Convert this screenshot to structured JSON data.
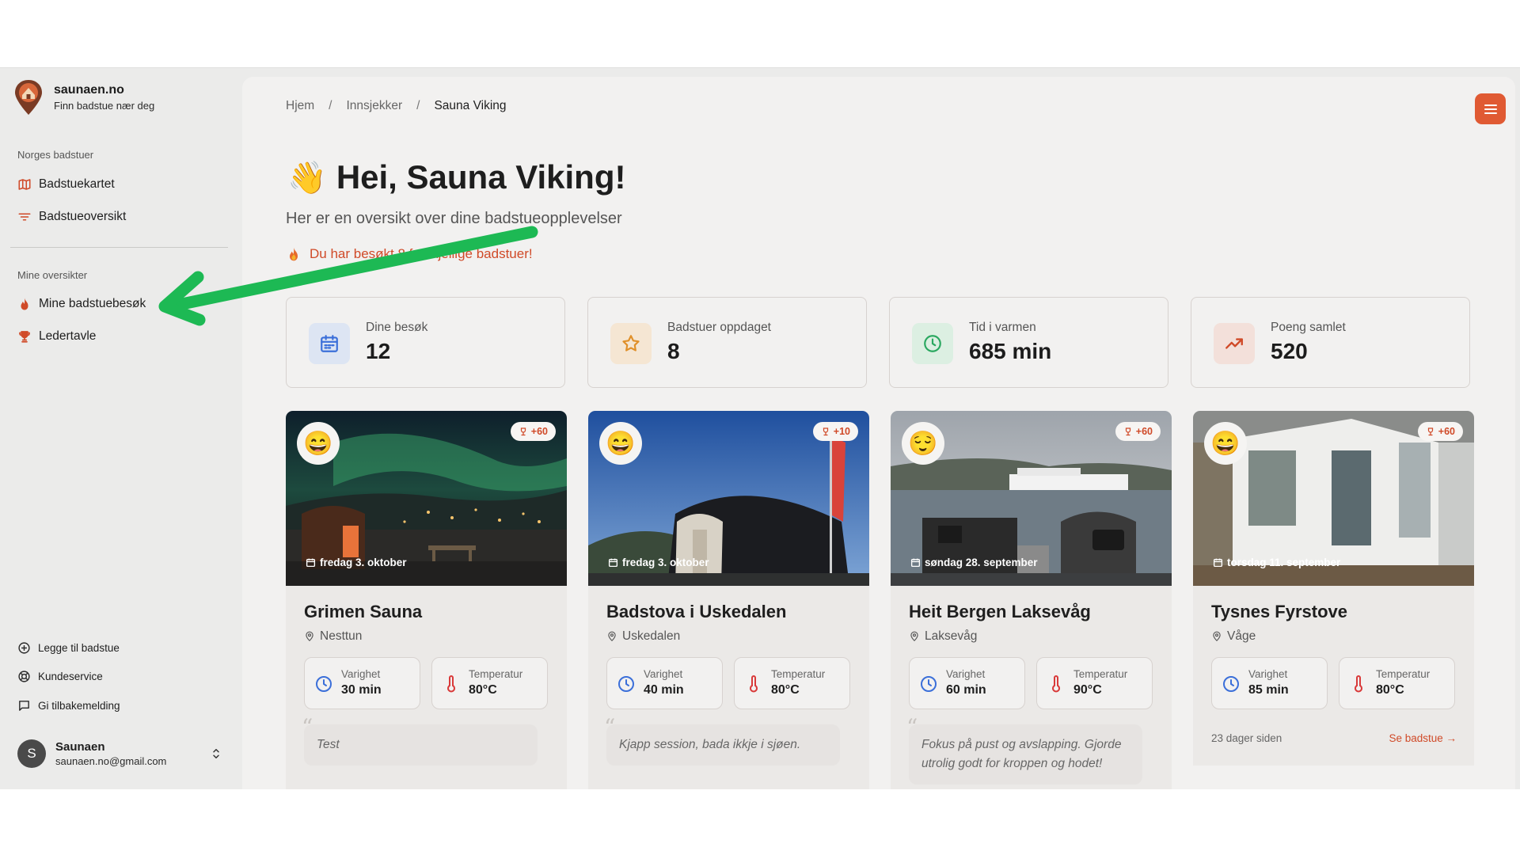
{
  "brand": {
    "name": "saunaen.no",
    "tagline": "Finn badstue nær deg"
  },
  "sidebar": {
    "section1_label": "Norges badstuer",
    "section1_items": [
      {
        "label": "Badstuekartet",
        "icon": "map-icon"
      },
      {
        "label": "Badstueoversikt",
        "icon": "filter-icon"
      }
    ],
    "section2_label": "Mine oversikter",
    "section2_items": [
      {
        "label": "Mine badstuebesøk",
        "icon": "flame-icon"
      },
      {
        "label": "Ledertavle",
        "icon": "trophy-icon"
      }
    ],
    "footer_items": [
      {
        "label": "Legge til badstue",
        "icon": "plus-circle-icon"
      },
      {
        "label": "Kundeservice",
        "icon": "lifebuoy-icon"
      },
      {
        "label": "Gi tilbakemelding",
        "icon": "message-icon"
      }
    ],
    "user": {
      "initial": "S",
      "name": "Saunaen",
      "email": "saunaen.no@gmail.com"
    }
  },
  "breadcrumb": {
    "items": [
      "Hjem",
      "Innsjekker",
      "Sauna Viking"
    ],
    "separator": "/"
  },
  "header": {
    "greeting_icon": "👋",
    "title": "Hei, Sauna Viking!",
    "subtitle": "Her er en oversikt over dine badstueopplevelser",
    "streak_text": "Du har besøkt 8 forskjellige badstuer!"
  },
  "stats": [
    {
      "label": "Dine besøk",
      "value": "12",
      "icon": "calendar-icon",
      "color": "#3b6fd9",
      "bg": "#dde5f3"
    },
    {
      "label": "Badstuer oppdaget",
      "value": "8",
      "icon": "star-icon",
      "color": "#e0902a",
      "bg": "#f5e6d3"
    },
    {
      "label": "Tid i varmen",
      "value": "685 min",
      "icon": "clock-icon",
      "color": "#2aa860",
      "bg": "#dcefe2"
    },
    {
      "label": "Poeng samlet",
      "value": "520",
      "icon": "trending-up-icon",
      "color": "#d04a28",
      "bg": "#f3e0da"
    }
  ],
  "labels": {
    "duration": "Varighet",
    "temperature": "Temperatur"
  },
  "visits": [
    {
      "date": "fredag 3. oktober",
      "points": "+60",
      "name": "Grimen Sauna",
      "location": "Nesttun",
      "duration": "30 min",
      "temperature": "80°C",
      "note": "Test",
      "mood": "😄"
    },
    {
      "date": "fredag 3. oktober",
      "points": "+10",
      "name": "Badstova i Uskedalen",
      "location": "Uskedalen",
      "duration": "40 min",
      "temperature": "80°C",
      "note": "Kjapp session, bada ikkje i sjøen.",
      "mood": "😄"
    },
    {
      "date": "søndag 28. september",
      "points": "+60",
      "name": "Heit Bergen Laksevåg",
      "location": "Laksevåg",
      "duration": "60 min",
      "temperature": "90°C",
      "note": "Fokus på pust og avslapping. Gjorde utrolig godt for kroppen og hodet!",
      "mood": "😌"
    },
    {
      "date": "torsdag 11. september",
      "points": "+60",
      "name": "Tysnes Fyrstove",
      "location": "Våge",
      "duration": "85 min",
      "temperature": "80°C",
      "ago": "23 dager siden",
      "see": "Se badstue →",
      "mood": "😄"
    }
  ],
  "colors": {
    "accent": "#d04a28",
    "menu_button": "#e05a33",
    "annotation_arrow": "#1db954"
  }
}
